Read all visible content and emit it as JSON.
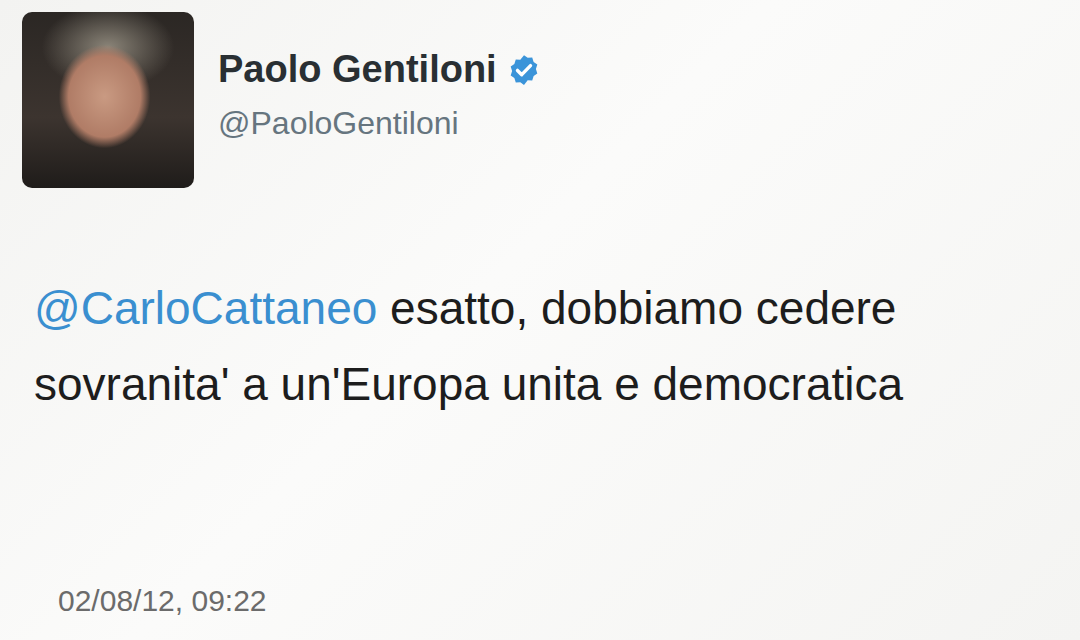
{
  "author": {
    "name": "Paolo Gentiloni",
    "handle": "@PaoloGentiloni",
    "verified": true
  },
  "tweet": {
    "mention": "@CarloCattaneo",
    "text": "esatto, dobbiamo cedere sovranita' a un'Europa unita e democratica",
    "timestamp": "02/08/12, 09:22"
  }
}
